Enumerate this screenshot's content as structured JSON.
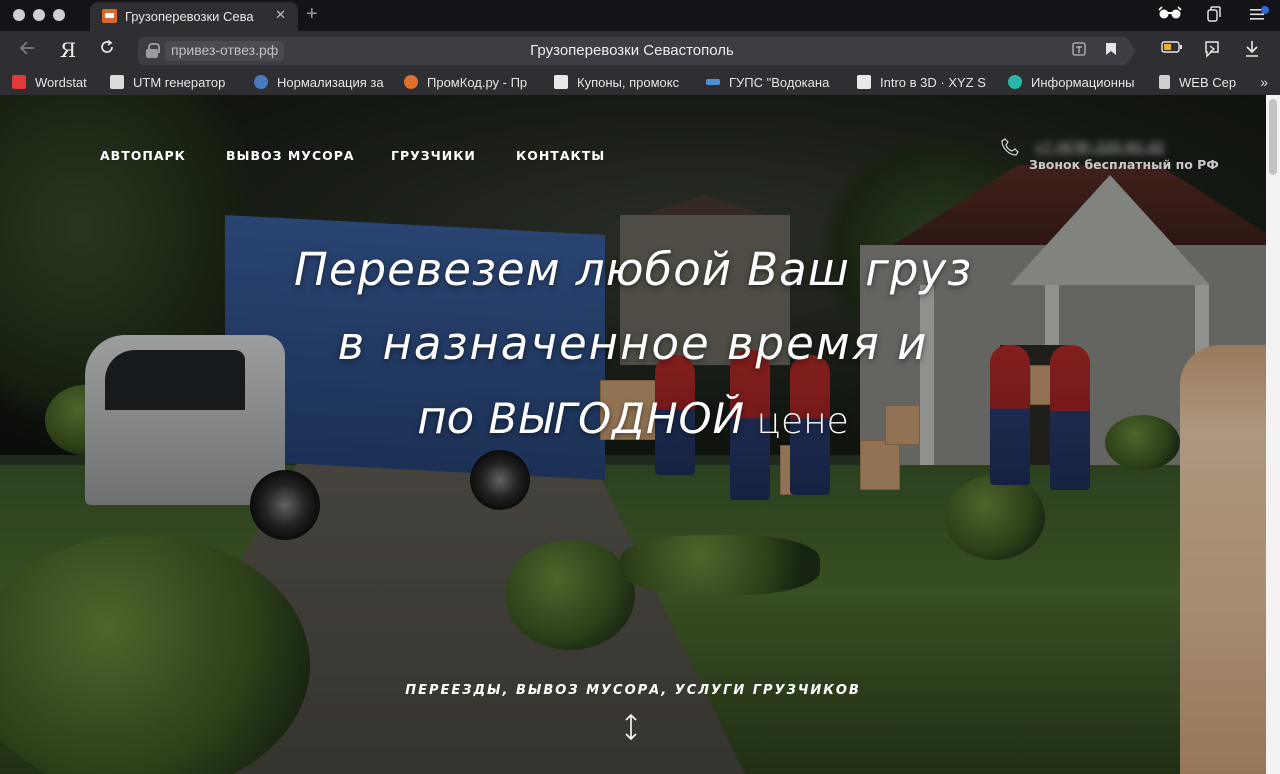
{
  "browser": {
    "tab_title": "Грузоперевозки Сева",
    "tab_close": "✕",
    "new_tab": "+",
    "yandex_button": "Я",
    "domain": "привез-отвез.рф",
    "page_title": "Грузоперевозки Севастополь"
  },
  "bookmarks": [
    {
      "label": "Wordstat",
      "icon": "wordstat-icon",
      "color": "#e03a3a"
    },
    {
      "label": "UTM генератор",
      "icon": "utm-icon",
      "color": "#dcdcdc"
    },
    {
      "label": "Нормализация за",
      "icon": "python-icon",
      "color": "#4a7bbf"
    },
    {
      "label": "ПромКод.ру - Пр",
      "icon": "promkod-icon",
      "color": "#e0702a"
    },
    {
      "label": "Купоны, промокс",
      "icon": "doc-icon",
      "color": "#e8e8e8"
    },
    {
      "label": "ГУПС \"Водокана",
      "icon": "water-icon",
      "color": "#4f8fd6"
    },
    {
      "label": "Intro в 3D · XYZ S",
      "icon": "xyz-icon",
      "color": "#eaeaea"
    },
    {
      "label": "Информационны",
      "icon": "info-icon",
      "color": "#2ab7a8"
    },
    {
      "label": "WEB Сер",
      "icon": "page-icon",
      "color": "#cfcfcf"
    }
  ],
  "site": {
    "nav": [
      "АВТОПАРК",
      "ВЫВОЗ МУСОРА",
      "ГРУЗЧИКИ",
      "КОНТАКТЫ"
    ],
    "phone": "+7 (978) 220-92-32",
    "phone_note": "Звонок бесплатный по РФ",
    "hero": {
      "line1": "Перевезем любой Ваш груз",
      "line2": "в назначенное время и",
      "line3_a": "по ",
      "line3_b": "ВЫГОДНОЙ",
      "line3_c": " цене"
    },
    "tagline": "ПЕРЕЕЗДЫ, ВЫВОЗ МУСОРА, УСЛУГИ ГРУЗЧИКОВ"
  },
  "colors": {
    "accent": "#ffffff",
    "chrome_bg": "#2e2e33",
    "tabbar_bg": "#141418"
  }
}
